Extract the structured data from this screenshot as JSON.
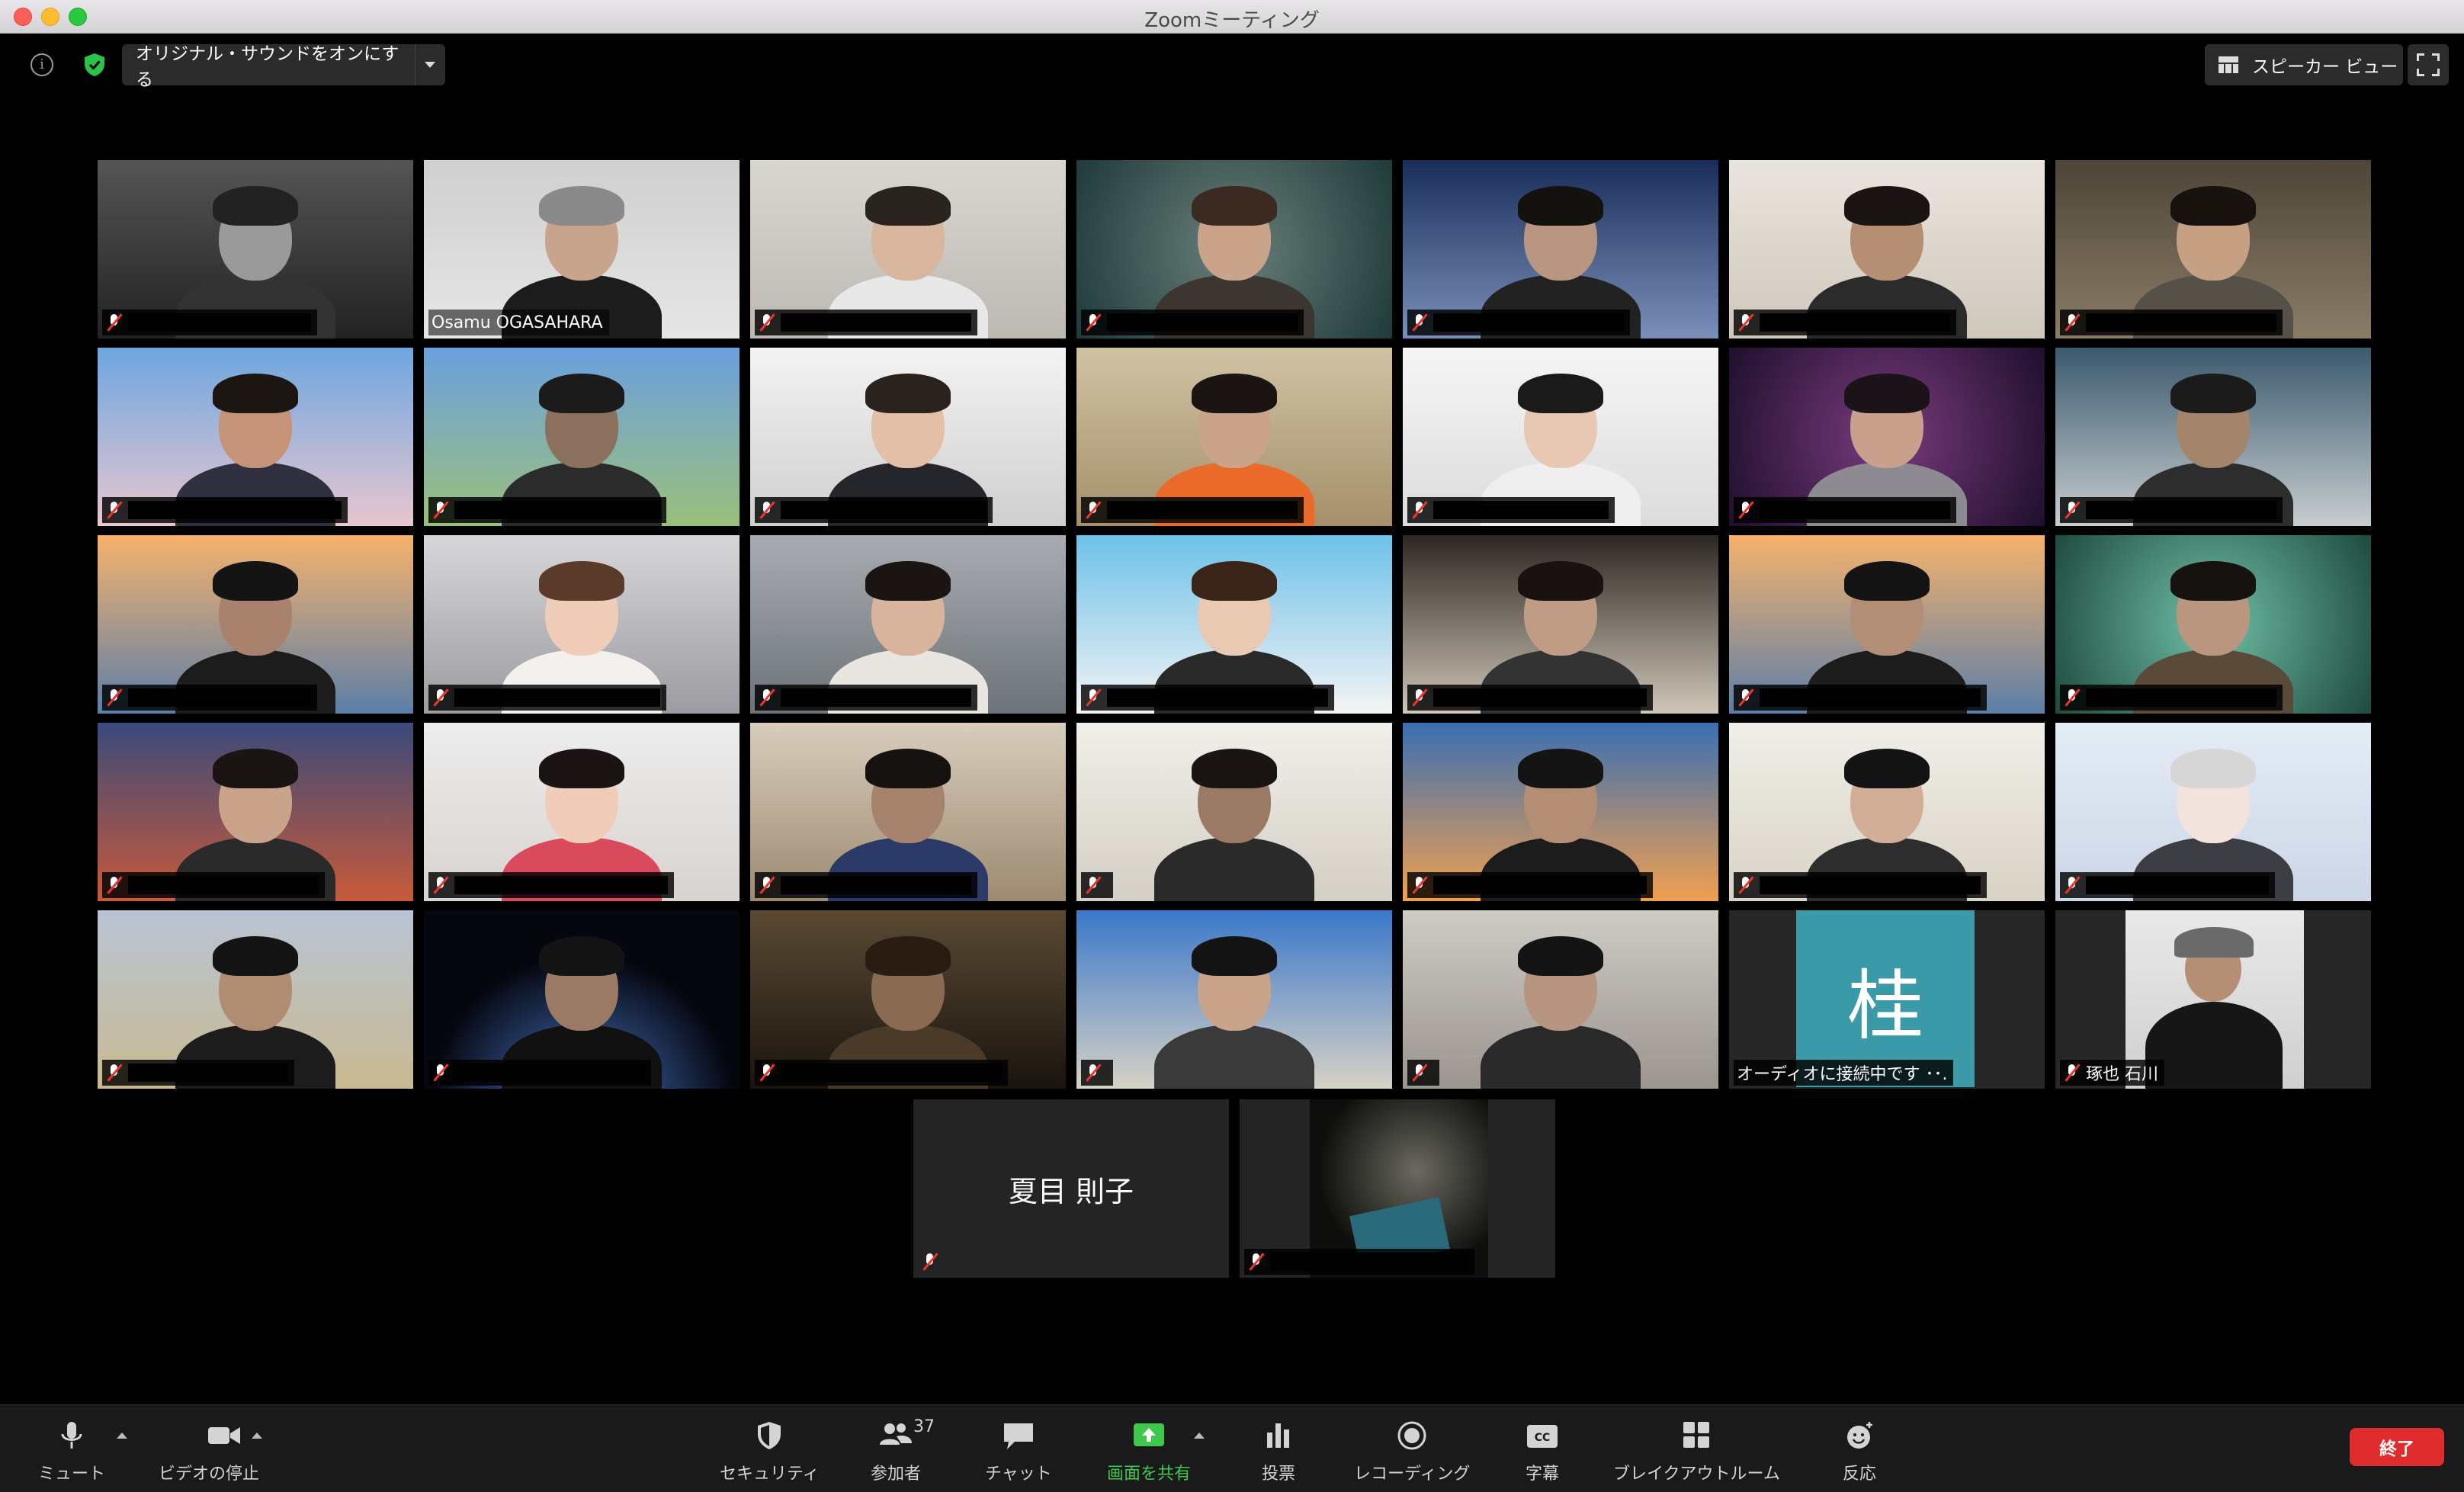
{
  "window": {
    "title": "Zoomミーティング"
  },
  "topbar": {
    "original_sound_label": "オリジナル・サウンドをオンにする",
    "view_label": "スピーカー ビュー"
  },
  "participants": {
    "active_speaker_name": "Osamu OGASAHARA",
    "audio_connecting_label": "オーディオに接続中です ･･.",
    "audio_connecting_avatar_char": "桂",
    "named_participant": "琢也 石川",
    "audio_only_participant": "夏目 則子"
  },
  "toolbar": {
    "mute": "ミュート",
    "stop_video": "ビデオの停止",
    "security": "セキュリティ",
    "participants": "参加者",
    "participants_count": "37",
    "chat": "チャット",
    "share_screen": "画面を共有",
    "poll": "投票",
    "record": "レコーディング",
    "captions": "字幕",
    "breakout": "ブレイクアウトルーム",
    "reactions": "反応",
    "end": "終了"
  },
  "colors": {
    "share_green": "#3ec94d",
    "end_red": "#e02c2c",
    "active_speaker_outline": "#c9e87a",
    "kei_avatar_bg": "#3a9aa8"
  }
}
